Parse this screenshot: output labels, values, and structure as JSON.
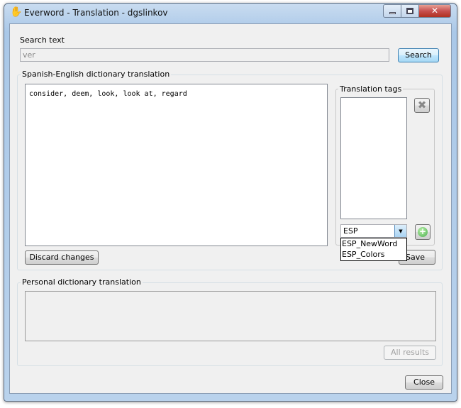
{
  "window": {
    "title": "Everword - Translation - dgslinkov",
    "icon": "hand-wave-icon"
  },
  "search": {
    "label": "Search text",
    "value": "ver",
    "button": "Search"
  },
  "dictionary": {
    "group_label": "Spanish-English dictionary translation",
    "text": "consider, deem, look, look at, regard",
    "discard_button": "Discard changes",
    "save_button": "Save"
  },
  "tags": {
    "group_label": "Translation tags",
    "combo_value": "ESP",
    "options": [
      "ESP_NewWord",
      "ESP_Colors"
    ],
    "remove_icon": "x-icon",
    "add_icon": "plus-circle-icon"
  },
  "personal": {
    "group_label": "Personal dictionary translation",
    "all_results_button": "All results"
  },
  "footer": {
    "close_button": "Close"
  },
  "colors": {
    "accent": "#3c7fb1",
    "close_red": "#c75050",
    "add_green": "#4caf50"
  }
}
